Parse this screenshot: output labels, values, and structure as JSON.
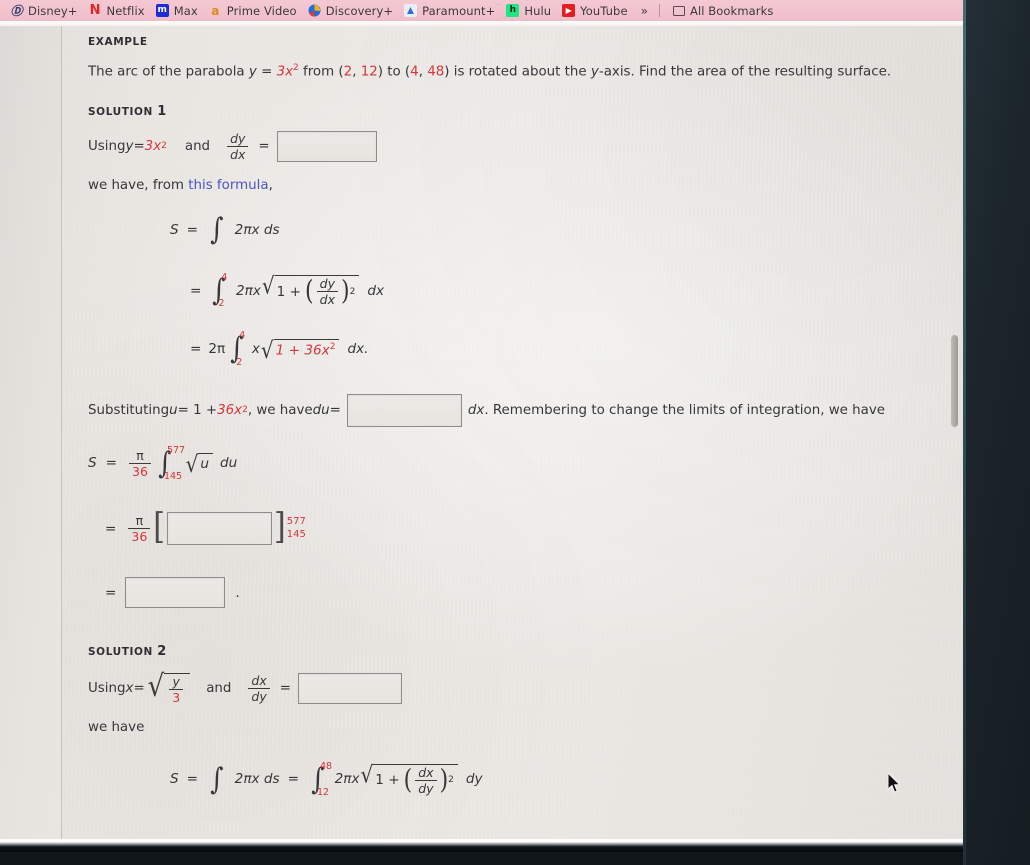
{
  "browser": {
    "bookmarks": [
      {
        "label": "Disney+",
        "icon": "disney-plus-icon",
        "glyph": "Ⓓ"
      },
      {
        "label": "Netflix",
        "icon": "netflix-icon",
        "glyph": "N"
      },
      {
        "label": "Max",
        "icon": "max-icon",
        "glyph": "m"
      },
      {
        "label": "Prime Video",
        "icon": "amazon-prime-icon",
        "glyph": "a"
      },
      {
        "label": "Discovery+",
        "icon": "discovery-plus-icon",
        "glyph": ""
      },
      {
        "label": "Paramount+",
        "icon": "paramount-plus-icon",
        "glyph": "▲"
      },
      {
        "label": "Hulu",
        "icon": "hulu-icon",
        "glyph": "h"
      },
      {
        "label": "YouTube",
        "icon": "youtube-icon",
        "glyph": "▶"
      }
    ],
    "overflow_label": "»",
    "all_bookmarks_label": "All Bookmarks"
  },
  "page": {
    "example_label": "EXAMPLE",
    "problem": {
      "t1": "The arc of the parabola ",
      "y1": "y",
      "eq1": " = ",
      "expr1": "3x",
      "pow1": "2",
      "t2": " from (",
      "p1x": "2",
      "pc1": ", ",
      "p1y": "12",
      "t3": ") to (",
      "p2x": "4",
      "pc2": ", ",
      "p2y": "48",
      "t4": ") is rotated about the ",
      "axis": "y",
      "t5": "-axis. Find the area of the resulting surface."
    },
    "solution1": {
      "label": "SOLUTION",
      "number": "1",
      "using_text": "Using ",
      "using_y": "y",
      "using_eq": " = ",
      "using_expr": "3x",
      "using_pow": "2",
      "and_text": "and",
      "dy": "dy",
      "dx": "dx",
      "equals": "=",
      "answer_1": "",
      "we_have_prefix": "we have, from ",
      "link_text": "this formula",
      "we_have_suffix": ",",
      "line_S": "S",
      "line_eq": "=",
      "line_integrand1": "2πx ds",
      "line2_lower": "2",
      "line2_upper": "4",
      "line2_coef": "2πx",
      "line2_one": "1 +",
      "line2_num": "dy",
      "line2_den": "dx",
      "line2_pow": "2",
      "line2_diff": "dx",
      "line3_coef": "2π",
      "line3_lower": "2",
      "line3_upper": "4",
      "line3_x": "x",
      "line3_rad": "1 + 36x",
      "line3_radpow": "2",
      "line3_diff": "dx."
    },
    "substitution": {
      "prefix": "Substituting ",
      "u": "u",
      "eq": " = 1 + ",
      "coef": "36x",
      "pow": "2",
      "mid": ", we have ",
      "du": "du",
      "eq2": " = ",
      "answer_2": "",
      "dx": "dx",
      "suffix": ". Remembering to change the limits of integration, we have"
    },
    "result": {
      "S": "S",
      "eq": "=",
      "pi": "π",
      "den36": "36",
      "lower": "145",
      "upper": "577",
      "radicand": "u",
      "du": "du",
      "line2_eq": "=",
      "line2_pi": "π",
      "line2_den": "36",
      "answer_3": "",
      "line2_upper": "577",
      "line2_lower": "145",
      "line3_eq": "=",
      "answer_4": "",
      "period": "."
    },
    "solution2": {
      "label": "SOLUTION",
      "number": "2",
      "using_text": "Using ",
      "using_x": "x",
      "using_eq": " = ",
      "rad_num": "y",
      "rad_den": "3",
      "and_text": "and",
      "dx": "dx",
      "dy": "dy",
      "equals": "=",
      "answer_5": "",
      "we_have": "we have",
      "line_S": "S",
      "line_eq1": "=",
      "line_int1": "2πx ds",
      "line_eq2": "=",
      "line_lower": "12",
      "line_upper": "48",
      "line_coef": "2πx",
      "line_one": "1 +",
      "line_num": "dx",
      "line_den": "dy",
      "line_pow": "2",
      "line_diff": "dy"
    }
  },
  "theme": {
    "accent_red": "#d9343c",
    "link_blue": "#4b54c9",
    "paper_bg": "#eae7e3",
    "bookmark_bar_bg": "#f2c3ce",
    "text": "#36373a"
  }
}
